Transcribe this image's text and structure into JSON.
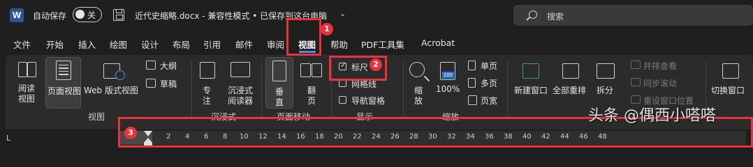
{
  "titlebar": {
    "app_logo": "W",
    "autosave_label": "自动保存",
    "toggle_state": "关",
    "doc_title": "近代史缩略.docx  -  兼容性模式 • 已保存到这台电脑",
    "search_placeholder": "搜索"
  },
  "menu": {
    "tabs": [
      "文件",
      "开始",
      "插入",
      "绘图",
      "设计",
      "布局",
      "引用",
      "邮件",
      "审阅",
      "视图",
      "帮助",
      "PDF工具集",
      "Acrobat"
    ],
    "active_tab": "视图"
  },
  "ribbon": {
    "views": {
      "read_mode": "阅读\n视图",
      "read_mode_l1": "阅读",
      "read_mode_l2": "视图",
      "print_layout": "页面视图",
      "web_layout": "Web 版式视图",
      "outline": "大纲",
      "draft": "草稿",
      "group_title": "视图"
    },
    "immersive": {
      "focus_l1": "专",
      "focus_l2": "注",
      "reader_l1": "沉浸式",
      "reader_l2": "阅读器",
      "group_title": "沉浸式"
    },
    "page_movement": {
      "vertical_l1": "垂",
      "vertical_l2": "直",
      "side_l1": "翻",
      "side_l2": "页",
      "group_title": "页面移动"
    },
    "show": {
      "ruler": "标尺",
      "gridlines": "网格线",
      "nav_pane": "导航窗格",
      "group_title": "显示",
      "ruler_checked": true
    },
    "zoom": {
      "zoom_l1": "缩",
      "zoom_l2": "放",
      "hundred": "100%",
      "hundred_icon": "100",
      "one_page": "单页",
      "multi_page": "多页",
      "page_width": "页宽",
      "group_title": "缩放"
    },
    "window": {
      "new_window": "新建窗口",
      "arrange_all": "全部重排",
      "split": "拆分",
      "side_by_side": "并排查看",
      "sync_scroll": "同步滚动",
      "reset_position": "重设窗口位置",
      "switch_windows": "切换窗口"
    }
  },
  "ruler": {
    "corner": "L",
    "numbers": [
      "2",
      "4",
      "6",
      "8",
      "10",
      "12",
      "14",
      "16",
      "18",
      "20",
      "22",
      "24",
      "26",
      "28",
      "30",
      "32",
      "34",
      "36",
      "38",
      "40",
      "42",
      "44",
      "46",
      "48"
    ]
  },
  "annotations": {
    "badge_1": "1",
    "badge_2": "2",
    "badge_3": "3",
    "color": "#e8323c"
  },
  "watermark": "头条 @偶西小嗒嗒"
}
